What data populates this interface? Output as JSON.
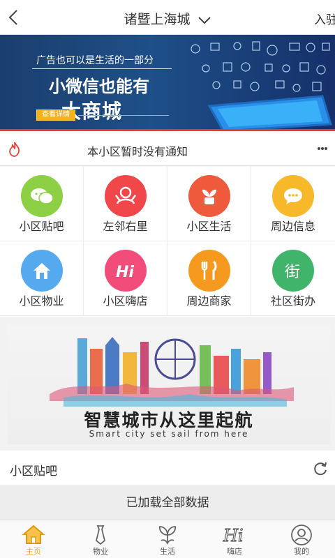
{
  "header": {
    "city": "诸暨上海城",
    "settle": "入驻"
  },
  "banner": {
    "line1": "广告也可以是生活的一部分",
    "line2": "小微信也能有",
    "line3": "大商城",
    "detail": "查看详情"
  },
  "notice": {
    "text": "本小区暂时没有通知"
  },
  "grid": [
    {
      "label": "小区贴吧",
      "color": "#8ed045",
      "icon": "chat-icon"
    },
    {
      "label": "左邻右里",
      "color": "#f2474a",
      "icon": "neighbors-icon"
    },
    {
      "label": "小区生活",
      "color": "#f05a3c",
      "icon": "plant-icon"
    },
    {
      "label": "周边信息",
      "color": "#f7b82a",
      "icon": "message-icon"
    },
    {
      "label": "小区物业",
      "color": "#55a9ee",
      "icon": "home-icon"
    },
    {
      "label": "小区嗨店",
      "color": "#f24c7a",
      "icon": "hi-icon"
    },
    {
      "label": "周边商家",
      "color": "#f59a1f",
      "icon": "fork-knife-icon"
    },
    {
      "label": "社区街办",
      "color": "#3fb46a",
      "icon": "street-icon"
    }
  ],
  "city_banner": {
    "title": "智慧城市从这里起航",
    "subtitle": "Smart city set sail from here"
  },
  "section": {
    "label": "小区贴吧"
  },
  "loaded": "已加载全部数据",
  "tabs": [
    {
      "label": "主页",
      "icon": "home-icon",
      "active": true
    },
    {
      "label": "物业",
      "icon": "tie-icon",
      "active": false
    },
    {
      "label": "生活",
      "icon": "flower-icon",
      "active": false
    },
    {
      "label": "嗨店",
      "icon": "hi-icon",
      "active": false
    },
    {
      "label": "我的",
      "icon": "user-icon",
      "active": false
    }
  ],
  "colors": {
    "accent": "#f2a81c",
    "banner_red": "#e43a2a"
  }
}
